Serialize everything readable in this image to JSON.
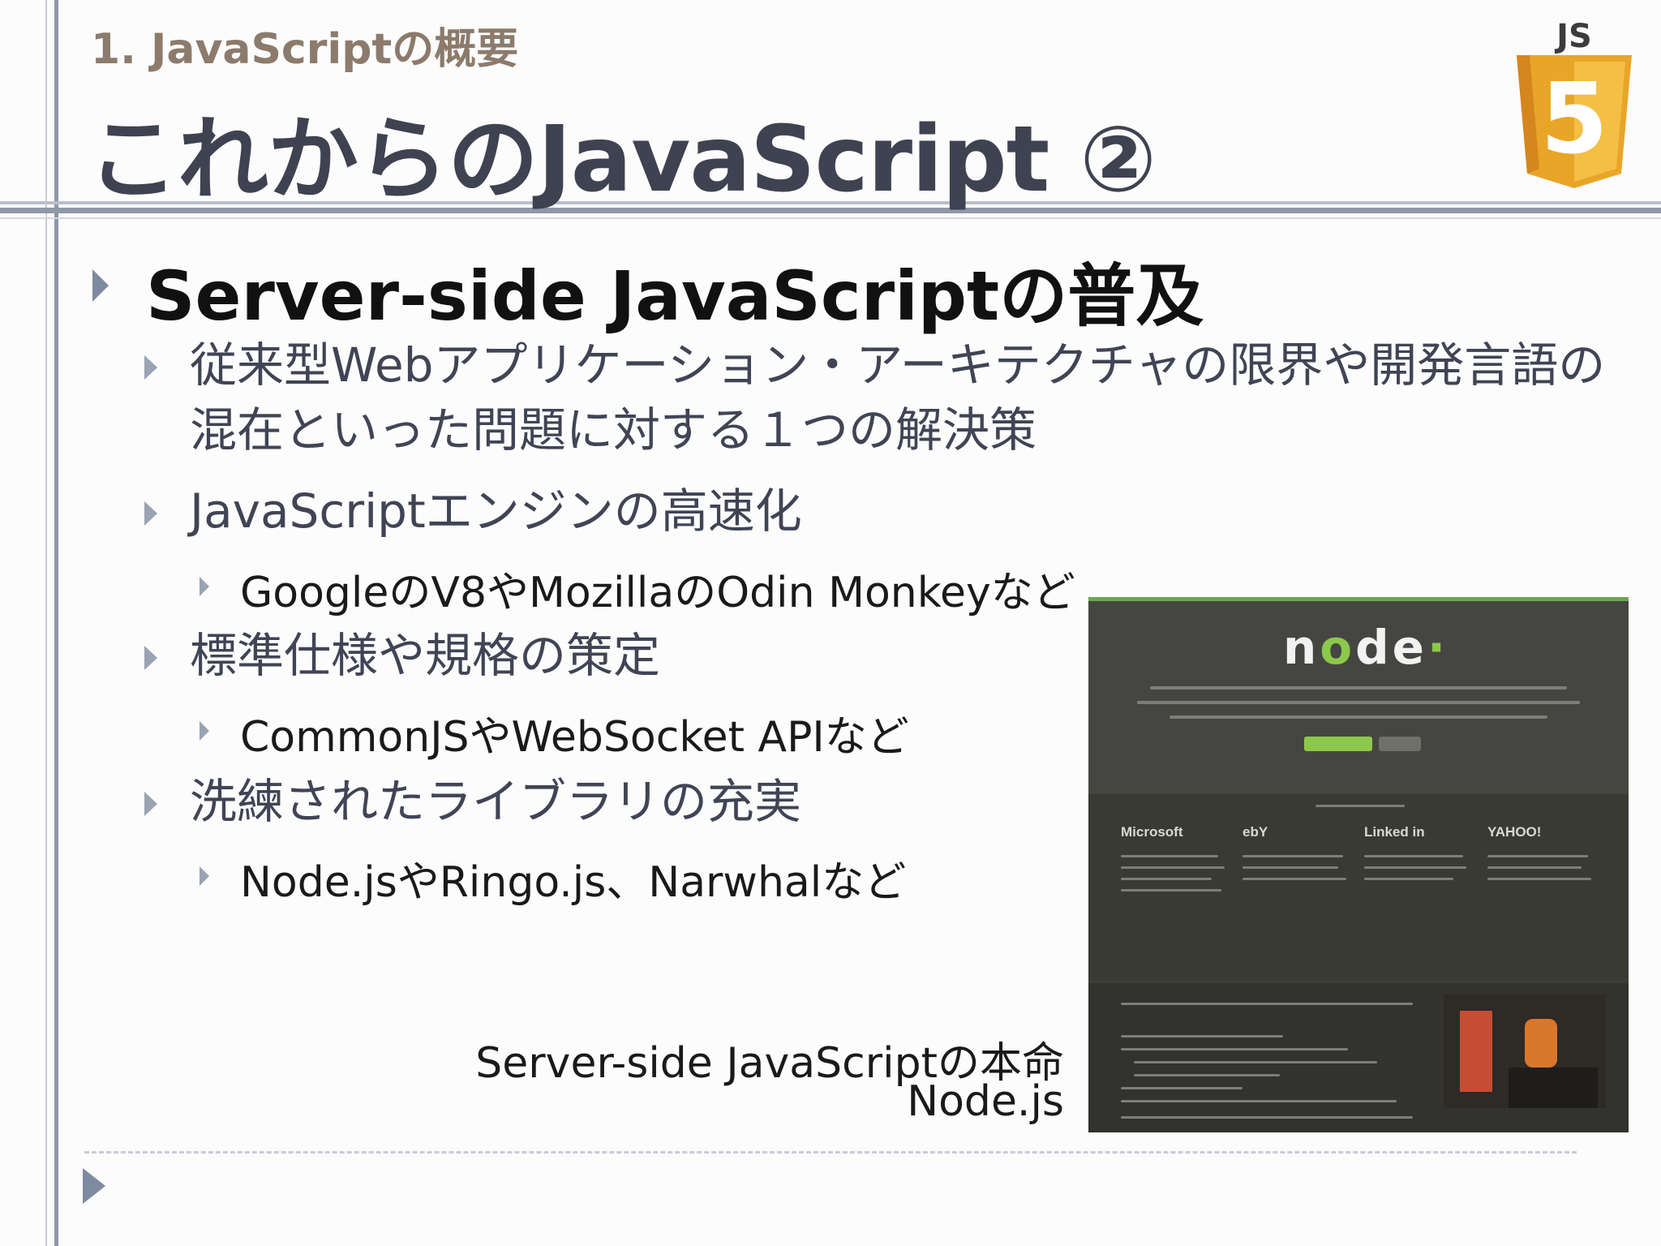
{
  "header": {
    "section": "1. JavaScriptの概要",
    "title": "これからのJavaScript ②"
  },
  "logo": {
    "label": "JS",
    "digit": "5",
    "colors": {
      "shield": "#e9a528",
      "shield_dark": "#d5861c",
      "text": "#3c3c3c"
    }
  },
  "bullets": {
    "main": "Server-side JavaScriptの普及",
    "b1_line1": "従来型Webアプリケーション・アーキテクチャの限界や開発言語の",
    "b1_line2": "混在といった問題に対する１つの解決策",
    "b2": "JavaScriptエンジンの高速化",
    "b2_sub": "GoogleのV8やMozillaのOdin Monkeyなど",
    "b3": "標準仕様や規格の策定",
    "b3_sub": "CommonJSやWebSocket APIなど",
    "b4": "洗練されたライブラリの充実",
    "b4_sub": "Node.jsやRingo.js、Narwhalなど"
  },
  "screenshot": {
    "logos": [
      "Microsoft",
      "ebY",
      "Linked in",
      "YAHOO!"
    ],
    "colors": {
      "accent": "#8cc84b",
      "bg": "#3c3c37"
    }
  },
  "caption": {
    "line1": "Server-side JavaScriptの本命",
    "line2": "Node.js"
  }
}
